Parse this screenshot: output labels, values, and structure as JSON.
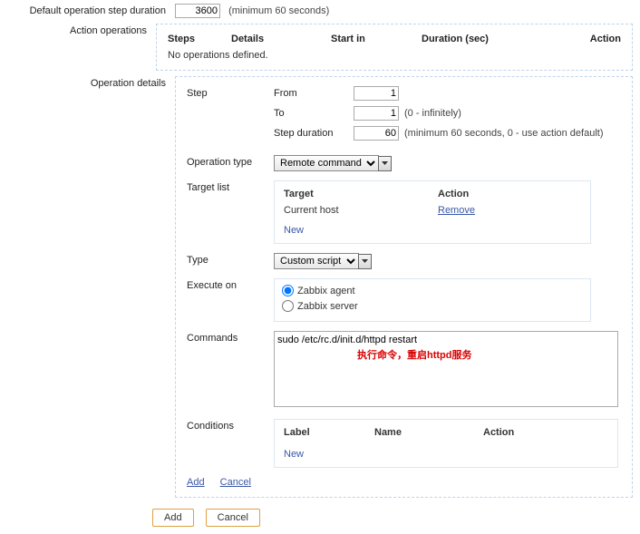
{
  "default_step": {
    "label": "Default operation step duration",
    "value": "3600",
    "hint": "(minimum 60 seconds)"
  },
  "action_operations": {
    "label": "Action operations",
    "headers": {
      "steps": "Steps",
      "details": "Details",
      "start": "Start in",
      "duration": "Duration (sec)",
      "action": "Action"
    },
    "empty": "No operations defined."
  },
  "operation_details": {
    "label": "Operation details",
    "step": {
      "label": "Step",
      "from_label": "From",
      "from_value": "1",
      "to_label": "To",
      "to_value": "1",
      "to_hint": "(0 - infinitely)",
      "dur_label": "Step duration",
      "dur_value": "60",
      "dur_hint": "(minimum 60 seconds, 0 - use action default)"
    },
    "operation_type": {
      "label": "Operation type",
      "value": "Remote command"
    },
    "target_list": {
      "label": "Target list",
      "headers": {
        "target": "Target",
        "action": "Action"
      },
      "row": {
        "target": "Current host",
        "action": "Remove"
      },
      "new": "New"
    },
    "type": {
      "label": "Type",
      "value": "Custom script"
    },
    "execute_on": {
      "label": "Execute on",
      "agent": "Zabbix agent",
      "server": "Zabbix server"
    },
    "commands": {
      "label": "Commands",
      "value": "sudo /etc/rc.d/init.d/httpd restart",
      "annotation": "执行命令，重启httpd服务"
    },
    "conditions": {
      "label": "Conditions",
      "headers": {
        "label": "Label",
        "name": "Name",
        "action": "Action"
      },
      "new": "New"
    },
    "add": "Add",
    "cancel": "Cancel"
  },
  "footer": {
    "add": "Add",
    "cancel": "Cancel"
  }
}
